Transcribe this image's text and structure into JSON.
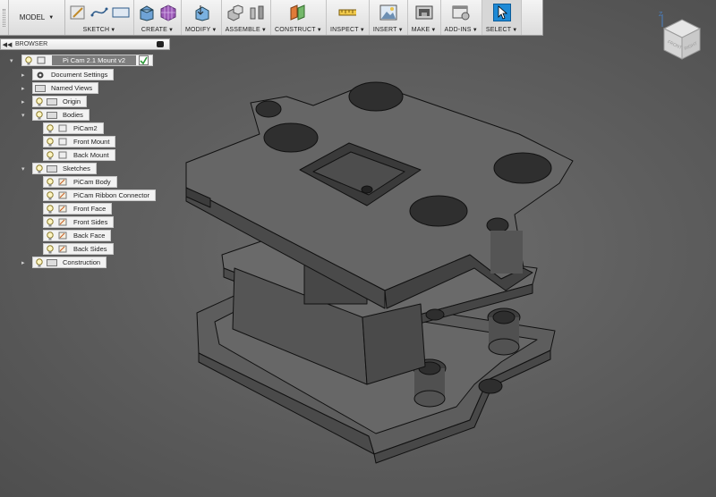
{
  "toolbar": {
    "workspace": "MODEL",
    "groups": [
      {
        "label": "SKETCH"
      },
      {
        "label": "CREATE"
      },
      {
        "label": "MODIFY"
      },
      {
        "label": "ASSEMBLE"
      },
      {
        "label": "CONSTRUCT"
      },
      {
        "label": "INSPECT"
      },
      {
        "label": "INSERT"
      },
      {
        "label": "MAKE"
      },
      {
        "label": "ADD-INS"
      },
      {
        "label": "SELECT"
      }
    ]
  },
  "browser": {
    "title": "BROWSER",
    "root": "Pi Cam 2.1 Mount v2",
    "items": [
      {
        "label": "Document Settings"
      },
      {
        "label": "Named Views"
      },
      {
        "label": "Origin"
      },
      {
        "label": "Bodies"
      },
      {
        "label": "PiCam2"
      },
      {
        "label": "Front Mount"
      },
      {
        "label": "Back Mount"
      },
      {
        "label": "Sketches"
      },
      {
        "label": "PiCam Body"
      },
      {
        "label": "PiCam Ribbon Connector"
      },
      {
        "label": "Front Face"
      },
      {
        "label": "Front Sides"
      },
      {
        "label": "Back Face"
      },
      {
        "label": "Back Sides"
      },
      {
        "label": "Construction"
      }
    ]
  },
  "viewcube": {
    "axis": "Z",
    "faces": [
      "FRONT",
      "RIGHT"
    ]
  },
  "colors": {
    "accent": "#1e8ad6",
    "viewport": "#606060",
    "part": "#5a5a5a"
  }
}
